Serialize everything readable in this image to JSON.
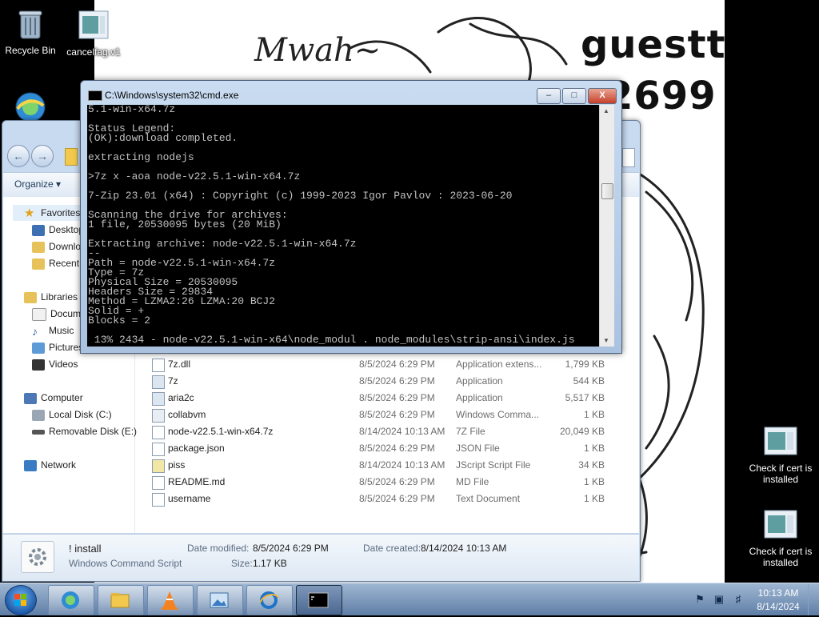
{
  "desktop": {
    "icons": {
      "recycle_bin": "Recycle Bin",
      "cancel_file": "cancelfag.v1",
      "cert_check_1": "Check if cert is installed",
      "cert_check_2": "Check if cert is installed"
    },
    "wallpaper": {
      "handwriting": "Mwah~",
      "line1": "guestt",
      "line2": "2699"
    }
  },
  "cmd_window": {
    "title": "C:\\Windows\\system32\\cmd.exe",
    "lines": [
      "5.1-win-x64.7z",
      "",
      "Status Legend:",
      "(OK):download completed.",
      "",
      "extracting nodejs",
      "",
      ">7z x -aoa node-v22.5.1-win-x64.7z",
      "",
      "7-Zip 23.01 (x64) : Copyright (c) 1999-2023 Igor Pavlov : 2023-06-20",
      "",
      "Scanning the drive for archives:",
      "1 file, 20530095 bytes (20 MiB)",
      "",
      "Extracting archive: node-v22.5.1-win-x64.7z",
      "--",
      "Path = node-v22.5.1-win-x64.7z",
      "Type = 7z",
      "Physical Size = 20530095",
      "Headers Size = 29834",
      "Method = LZMA2:26 LZMA:20 BCJ2",
      "Solid = +",
      "Blocks = 2",
      "",
      " 13% 2434 - node-v22.5.1-win-x64\\node_modul . node_modules\\strip-ansi\\index.js"
    ],
    "buttons": {
      "minimize": "–",
      "maximize": "□",
      "close": "X"
    }
  },
  "explorer": {
    "toolbar": {
      "organize": "Organize ▾"
    },
    "nav": {
      "favorites": "Favorites",
      "desktop": "Desktop",
      "downloads": "Downlo",
      "recent": "Recent",
      "libraries": "Libraries",
      "documents": "Docume",
      "music": "Music",
      "pictures": "Pictures",
      "videos": "Videos",
      "computer": "Computer",
      "local_disk": "Local Disk (C:)",
      "removable": "Removable Disk (E:)",
      "network": "Network"
    },
    "files": [
      {
        "name": "7z.dll",
        "date": "8/5/2024 6:29 PM",
        "type": "Application extens...",
        "size": "1,799 KB",
        "icon": "dll-icon"
      },
      {
        "name": "7z",
        "date": "8/5/2024 6:29 PM",
        "type": "Application",
        "size": "544 KB",
        "icon": "application-icon"
      },
      {
        "name": "aria2c",
        "date": "8/5/2024 6:29 PM",
        "type": "Application",
        "size": "5,517 KB",
        "icon": "application-icon"
      },
      {
        "name": "collabvm",
        "date": "8/5/2024 6:29 PM",
        "type": "Windows Comma...",
        "size": "1 KB",
        "icon": "command-script-icon"
      },
      {
        "name": "node-v22.5.1-win-x64.7z",
        "date": "8/14/2024 10:13 AM",
        "type": "7Z File",
        "size": "20,049 KB",
        "icon": "file-icon"
      },
      {
        "name": "package.json",
        "date": "8/5/2024 6:29 PM",
        "type": "JSON File",
        "size": "1 KB",
        "icon": "file-icon"
      },
      {
        "name": "piss",
        "date": "8/14/2024 10:13 AM",
        "type": "JScript Script File",
        "size": "34 KB",
        "icon": "script-icon"
      },
      {
        "name": "README.md",
        "date": "8/5/2024 6:29 PM",
        "type": "MD File",
        "size": "1 KB",
        "icon": "file-icon"
      },
      {
        "name": "username",
        "date": "8/5/2024 6:29 PM",
        "type": "Text Document",
        "size": "1 KB",
        "icon": "text-file-icon"
      }
    ],
    "details": {
      "name": "! install",
      "type": "Windows Command Script",
      "modified_label": "Date modified:",
      "modified_value": "8/5/2024 6:29 PM",
      "size_label": "Size:",
      "size_value": "1.17 KB",
      "created_label": "Date created:",
      "created_value": "8/14/2024 10:13 AM"
    }
  },
  "taskbar": {
    "clock_time": "10:13 AM",
    "clock_date": "8/14/2024"
  }
}
